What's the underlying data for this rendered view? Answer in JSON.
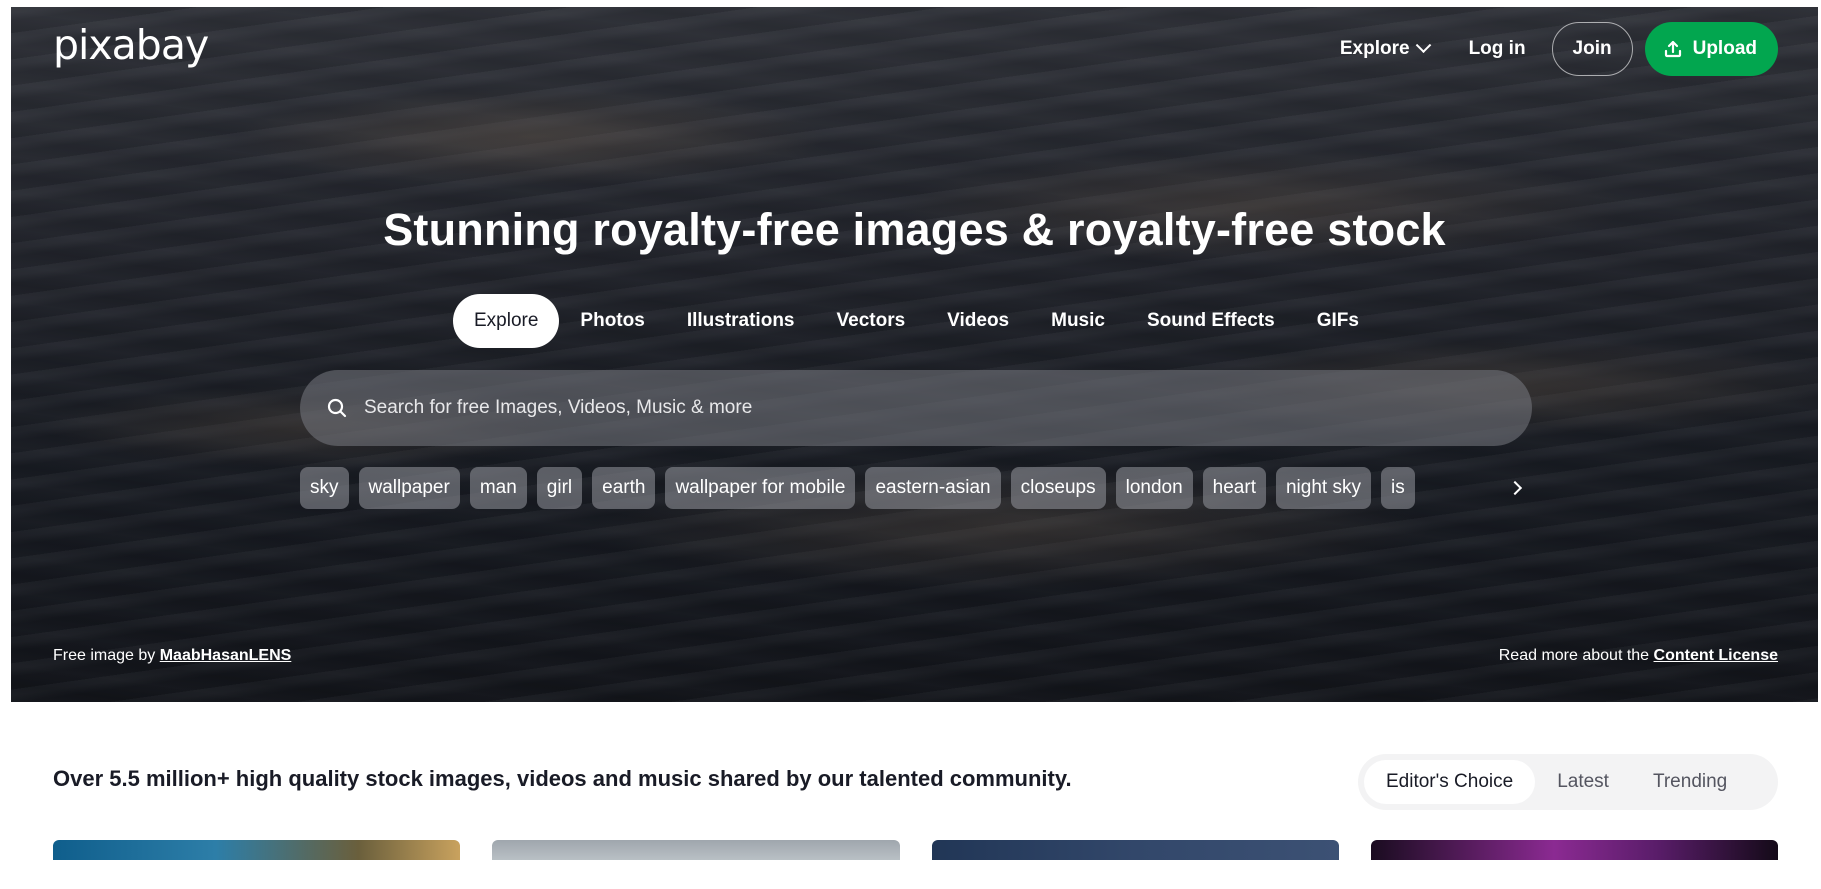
{
  "brand": {
    "logo_text": "pixabay"
  },
  "topnav": {
    "explore": "Explore",
    "login": "Log in",
    "join": "Join",
    "upload": "Upload"
  },
  "hero": {
    "headline": "Stunning royalty-free images & royalty-free stock",
    "tabs": [
      "Explore",
      "Photos",
      "Illustrations",
      "Vectors",
      "Videos",
      "Music",
      "Sound Effects",
      "GIFs"
    ],
    "active_tab": "Explore",
    "search_placeholder": "Search for free Images, Videos, Music & more",
    "tags": [
      "sky",
      "wallpaper",
      "man",
      "girl",
      "earth",
      "wallpaper for mobile",
      "eastern-asian",
      "closeups",
      "london",
      "heart",
      "night sky",
      "is"
    ],
    "credit_prefix": "Free image by",
    "credit_author": "MaabHasanLENS",
    "license_prefix": "Read more about the",
    "license_link": "Content License"
  },
  "main": {
    "tagline": "Over 5.5 million+ high quality stock images, videos and music shared by our talented community.",
    "sort_options": [
      "Editor's Choice",
      "Latest",
      "Trending"
    ],
    "active_sort": "Editor's Choice"
  },
  "colors": {
    "upload_green": "#02a64f",
    "text_dark": "#191b26"
  },
  "icons": {
    "search": "search-icon",
    "upload": "upload-icon",
    "chevron_down": "chevron-down-icon",
    "chevron_right": "chevron-right-icon"
  }
}
